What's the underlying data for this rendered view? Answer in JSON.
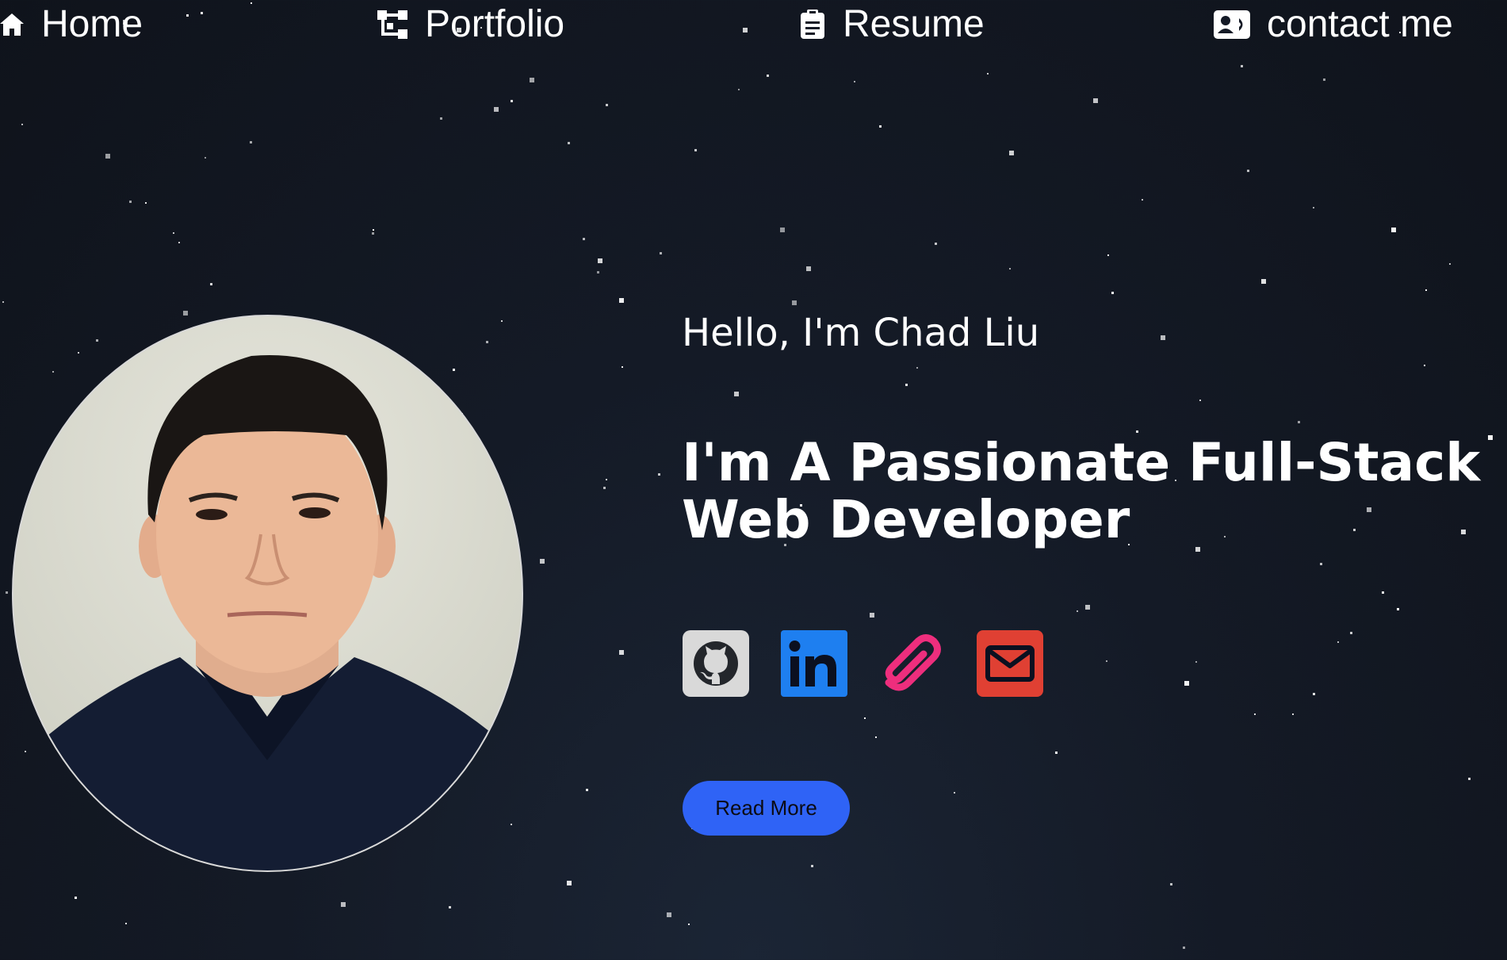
{
  "nav": {
    "items": [
      {
        "id": "home",
        "label": "Home",
        "icon": "home-icon"
      },
      {
        "id": "portfolio",
        "label": "Portfolio",
        "icon": "sitemap-icon"
      },
      {
        "id": "resume",
        "label": "Resume",
        "icon": "clipboard-icon"
      },
      {
        "id": "contact",
        "label": "contact me",
        "icon": "contact-card-icon"
      }
    ]
  },
  "hero": {
    "greeting": "Hello, I'm Chad Liu",
    "headline": "I'm A Passionate Full-Stack Web Developer",
    "read_more_label": "Read More"
  },
  "socials": [
    {
      "name": "github",
      "icon": "github-icon",
      "color": "#d9d9d9"
    },
    {
      "name": "linkedin",
      "icon": "linkedin-icon",
      "color": "#1e7ff0"
    },
    {
      "name": "resume",
      "icon": "paperclip-icon",
      "color": "#ee2e7d"
    },
    {
      "name": "email",
      "icon": "envelope-icon",
      "color": "#e04033"
    }
  ],
  "colors": {
    "background": "#141a26",
    "accent": "#2f63f6",
    "text": "#ffffff"
  }
}
